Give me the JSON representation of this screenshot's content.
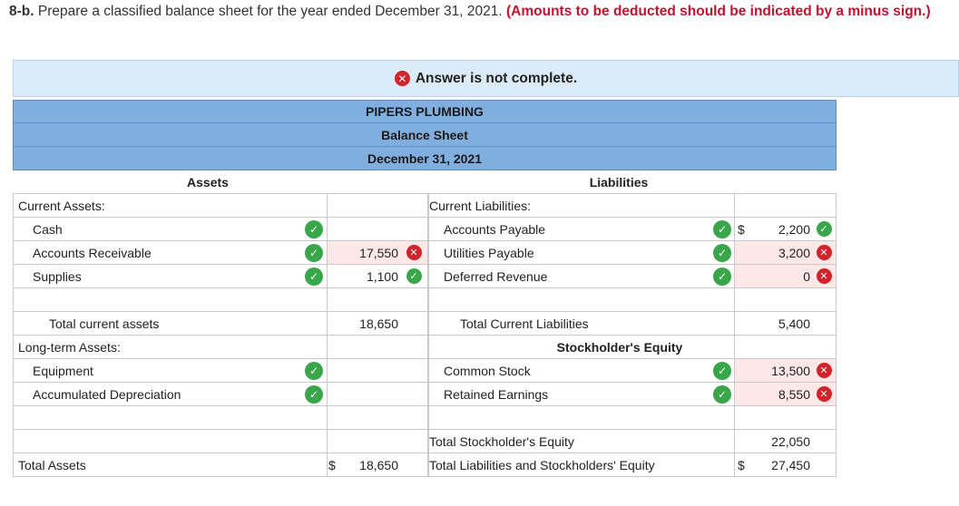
{
  "question": {
    "number": "8-b.",
    "text": " Prepare a classified balance sheet for the year ended December 31, 2021. ",
    "instruction": "(Amounts to be deducted should be indicated by a minus sign.)"
  },
  "banner": {
    "text": "Answer is not complete."
  },
  "header": {
    "company": "PIPERS PLUMBING",
    "statement": "Balance Sheet",
    "date": "December 31, 2021"
  },
  "columns": {
    "assets": "Assets",
    "liabilities": "Liabilities"
  },
  "rows": [
    {
      "a_label": "Current Assets:",
      "l_label": "Current Liabilities:"
    },
    {
      "a_label": "Cash",
      "a_status": "correct",
      "l_label": "Accounts Payable",
      "l_status": "correct",
      "l_currency": "$",
      "l_value": "2,200",
      "l_value_status": "correct"
    },
    {
      "a_label": "Accounts Receivable",
      "a_status": "correct",
      "a_value": "17,550",
      "a_value_status": "wrong",
      "l_label": "Utilities Payable",
      "l_status": "correct",
      "l_value": "3,200",
      "l_value_status": "wrong"
    },
    {
      "a_label": "Supplies",
      "a_status": "correct",
      "a_value": "1,100",
      "a_value_status": "correct",
      "l_label": "Deferred Revenue",
      "l_status": "correct",
      "l_value": "0",
      "l_value_status": "wrong"
    },
    {
      "a_label": "",
      "l_label": ""
    },
    {
      "a_label": "Total current assets",
      "a_value": "18,650",
      "l_label": "Total Current Liabilities",
      "l_value": "5,400"
    },
    {
      "a_label": "Long-term Assets:",
      "l_label": "Stockholder's Equity"
    },
    {
      "a_label": "Equipment",
      "a_status": "correct",
      "l_label": "Common Stock",
      "l_status": "correct",
      "l_value": "13,500",
      "l_value_status": "wrong"
    },
    {
      "a_label": "Accumulated Depreciation",
      "a_status": "correct",
      "l_label": "Retained Earnings",
      "l_status": "correct",
      "l_value": "8,550",
      "l_value_status": "wrong"
    },
    {
      "a_label": "",
      "l_label": ""
    },
    {
      "a_label": "",
      "l_label": "Total Stockholder's Equity",
      "l_value": "22,050"
    },
    {
      "a_label": "Total Assets",
      "a_currency": "$",
      "a_value": "18,650",
      "l_label": "Total Liabilities and Stockholders' Equity",
      "l_currency": "$",
      "l_value": "27,450"
    }
  ],
  "icons": {
    "correct": "check-circle-icon",
    "wrong": "x-circle-icon"
  },
  "colors": {
    "correct": "#3aa64a",
    "wrong": "#d2232a",
    "header_bg": "#7faedf",
    "banner_bg": "#dcebf8",
    "error_cell_bg": "#fde7e7"
  }
}
